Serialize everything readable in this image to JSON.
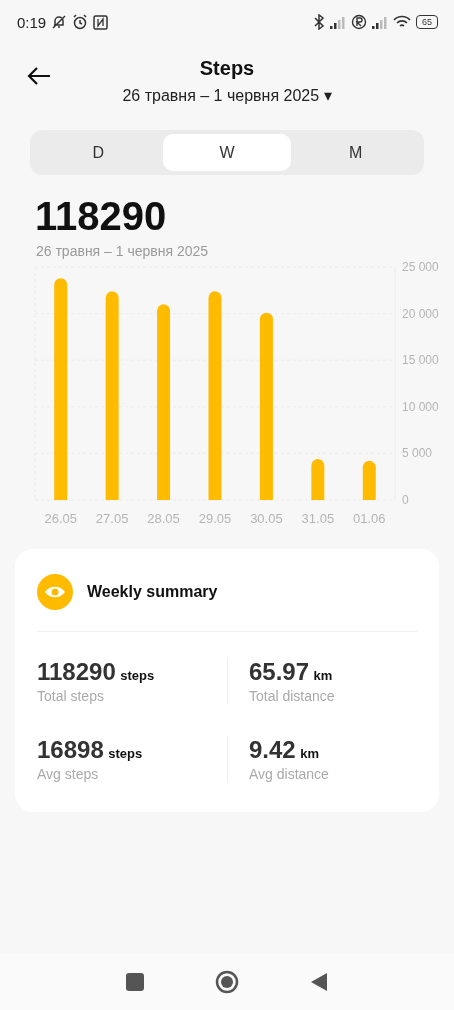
{
  "status_bar": {
    "time": "0:19",
    "battery": "65"
  },
  "header": {
    "title": "Steps",
    "date_range": "26 травня – 1 червня 2025",
    "dropdown_glyph": "▾"
  },
  "tabs": [
    {
      "label": "D",
      "selected": false
    },
    {
      "label": "W",
      "selected": true
    },
    {
      "label": "M",
      "selected": false
    }
  ],
  "total": {
    "value": "118290",
    "range": "26 травня – 1 червня 2025"
  },
  "chart": {
    "chart_data": {
      "type": "bar",
      "categories": [
        "26.05",
        "27.05",
        "28.05",
        "29.05",
        "30.05",
        "31.05",
        "01.06"
      ],
      "series": [
        {
          "color": "#ffbb00",
          "values": [
            23800,
            22400,
            21000,
            22400,
            20100,
            4400,
            4200
          ]
        }
      ],
      "grid": true,
      "ylim": [
        0,
        25000
      ],
      "yticks": [
        {
          "value": 0,
          "label": "0"
        },
        {
          "value": 5000,
          "label": "5 000"
        },
        {
          "value": 10000,
          "label": "10 000"
        },
        {
          "value": 15000,
          "label": "15 000"
        },
        {
          "value": 20000,
          "label": "20 000"
        },
        {
          "value": 25000,
          "label": "25 000"
        }
      ]
    }
  },
  "summary": {
    "title": "Weekly summary",
    "stats": [
      {
        "value": "118290",
        "unit": "steps",
        "label": "Total steps"
      },
      {
        "value": "65.97",
        "unit": "km",
        "label": "Total distance"
      },
      {
        "value": "16898",
        "unit": "steps",
        "label": "Avg steps"
      },
      {
        "value": "9.42",
        "unit": "km",
        "label": "Avg distance"
      }
    ]
  }
}
